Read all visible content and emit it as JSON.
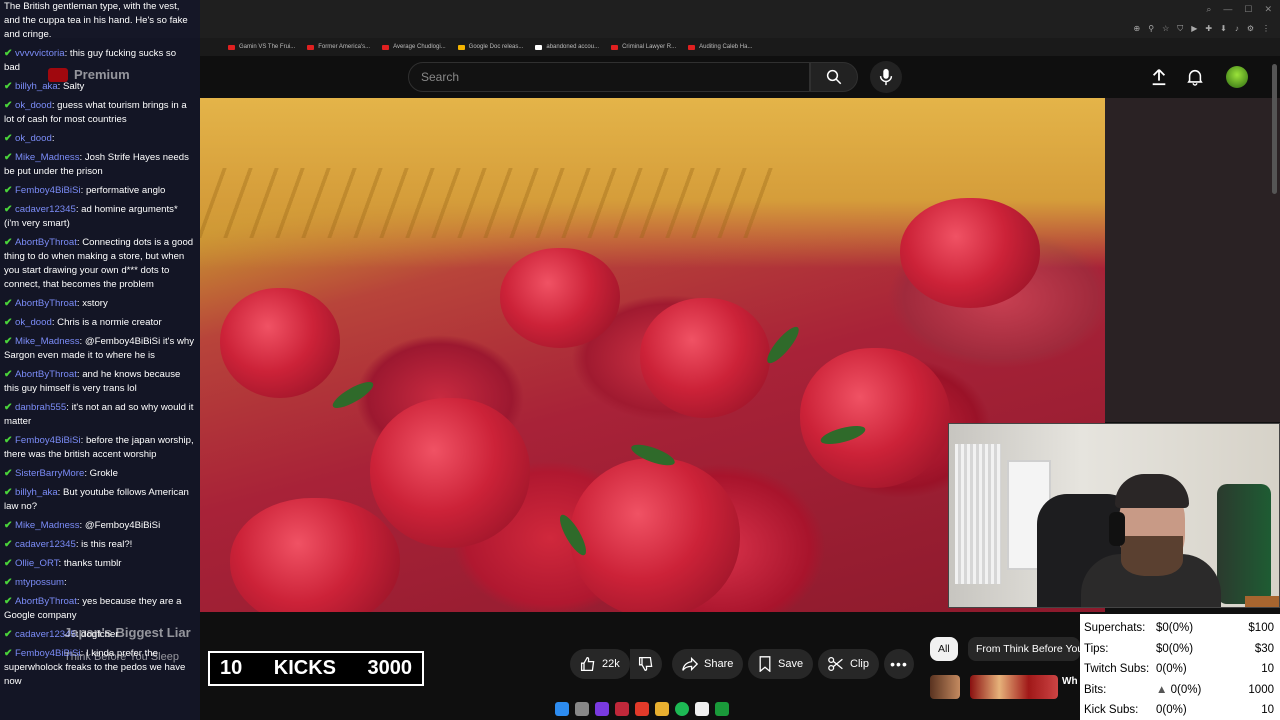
{
  "chat": {
    "messages": [
      {
        "user": "",
        "text": "The British gentleman type, with the vest, and the cuppa tea in his hand. He's so fake and cringe."
      },
      {
        "user": "vvvvvictoria",
        "text": "this guy fucking sucks so bad"
      },
      {
        "user": "billyh_aka",
        "text": "Salty"
      },
      {
        "user": "ok_dood",
        "text": "guess what tourism brings in a lot of cash for most countries"
      },
      {
        "user": "ok_dood",
        "text": ""
      },
      {
        "user": "Mike_Madness",
        "text": "Josh Strife Hayes needs be put under the prison"
      },
      {
        "user": "Femboy4BiBiSi",
        "text": "performative anglo"
      },
      {
        "user": "cadaver12345",
        "text": "ad homine arguments* (i'm very smart)"
      },
      {
        "user": "AbortByThroat",
        "text": "Connecting dots is a good thing to do when making a store, but when you start drawing your own d*** dots to connect, that becomes the problem"
      },
      {
        "user": "AbortByThroat",
        "text": "xstory"
      },
      {
        "user": "ok_dood",
        "text": "Chris is a normie creator"
      },
      {
        "user": "Mike_Madness",
        "text": "@Femboy4BiBiSi it's why Sargon even made it to where he is"
      },
      {
        "user": "AbortByThroat",
        "text": "and he knows because this guy himself is very trans lol"
      },
      {
        "user": "danbrah555",
        "text": "it's not an ad so why would it matter"
      },
      {
        "user": "Femboy4BiBiSi",
        "text": "before the japan worship, there was the british accent worship"
      },
      {
        "user": "SisterBarryMore",
        "text": "Grokle"
      },
      {
        "user": "billyh_aka",
        "text": "But youtube follows American law no?"
      },
      {
        "user": "Mike_Madness",
        "text": "@Femboy4BiBiSi"
      },
      {
        "user": "cadaver12345",
        "text": "is this real?!"
      },
      {
        "user": "Ollie_ORT",
        "text": "thanks tumblr"
      },
      {
        "user": "mtypossum",
        "text": ""
      },
      {
        "user": "AbortByThroat",
        "text": "yes because they are a Google company"
      },
      {
        "user": "cadaver12345",
        "text": "dogfcher"
      },
      {
        "user": "Femboy4BiBiSi",
        "text": "I kinda prefer the superwholock freaks to the pedos we have now"
      }
    ]
  },
  "browser": {
    "url_fragment": "youtube.com/watch?",
    "bookmarks": [
      "Gamin VS The Frui...",
      "Former America's...",
      "Average Chudlogi...",
      "Google Doc releas...",
      "abandoned accou...",
      "Criminal Lawyer R...",
      "Auditing Caleb Ha..."
    ]
  },
  "youtube": {
    "premium_label": "Premium",
    "search_placeholder": "Search",
    "video_title": "Japan's Biggest Liar",
    "channel": "Think Before You Sleep",
    "likes": "22k",
    "share": "Share",
    "save": "Save",
    "clip": "Clip",
    "chips": [
      "All",
      "From Think Before You..."
    ],
    "next_video_prefix": "Wh"
  },
  "kicks": {
    "count": "10",
    "label": "KICKS",
    "goal": "3000"
  },
  "stats": {
    "rows": [
      {
        "label": "Superchats:",
        "value": "$0(0%)",
        "goal": "$100"
      },
      {
        "label": "Tips:",
        "value": "$0(0%)",
        "goal": "$30"
      },
      {
        "label": "Twitch Subs:",
        "value": "0(0%)",
        "goal": "10"
      },
      {
        "label": "Bits:",
        "value": "0(0%)",
        "goal": "1000"
      },
      {
        "label": "Kick Subs:",
        "value": "0(0%)",
        "goal": "10"
      }
    ]
  },
  "colors": {
    "chat_user": "#7b8cf7",
    "badge": "#4ad33a",
    "yt_bg": "#0f0f0f"
  }
}
